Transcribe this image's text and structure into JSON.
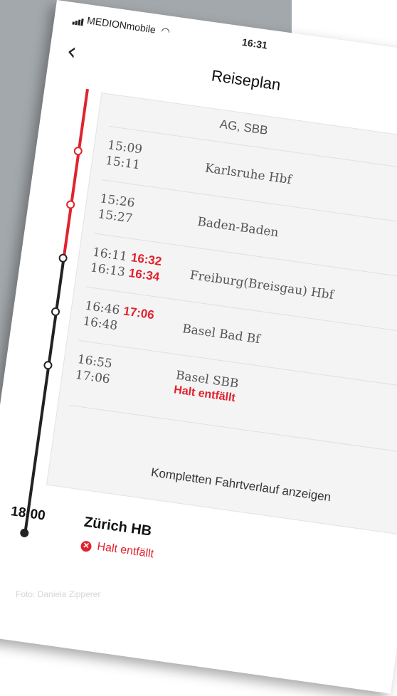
{
  "status_bar": {
    "carrier": "MEDIONmobile",
    "time": "16:31"
  },
  "header": {
    "title": "Reiseplan"
  },
  "partial_stop": {
    "name": "AG, SBB"
  },
  "stops": [
    {
      "arr": "15:09",
      "dep": "15:11",
      "name": "Karlsruhe Hbf"
    },
    {
      "arr": "15:26",
      "dep": "15:27",
      "name": "Baden-Baden"
    },
    {
      "arr": "16:11",
      "arr_delay": "16:32",
      "dep": "16:13",
      "dep_delay": "16:34",
      "name": "Freiburg(Breisgau) Hbf"
    },
    {
      "arr": "16:46",
      "arr_delay": "17:06",
      "dep": "16:48",
      "name": "Basel Bad Bf"
    },
    {
      "arr": "16:55",
      "dep": "17:06",
      "name": "Basel SBB",
      "note": "Halt entfällt"
    }
  ],
  "full_route_button": "Kompletten Fahrtverlauf anzeigen",
  "final_stop": {
    "time": "18:00",
    "name": "Zürich HB",
    "note": "Halt entfällt"
  },
  "caption": "Foto: Daniela Zipperer",
  "colors": {
    "accent": "#e0232e",
    "line_black": "#222222",
    "background_gray": "#a3a8ac"
  },
  "icons": {
    "back": "chevron-left-icon",
    "wifi": "wifi-icon",
    "signal": "signal-icon",
    "cancel": "x-circle-icon"
  }
}
